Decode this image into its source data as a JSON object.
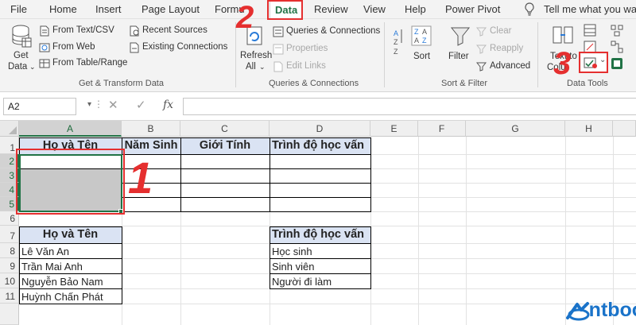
{
  "menu": {
    "tabs": [
      "File",
      "Home",
      "Insert",
      "Page Layout",
      "Formu",
      "Data",
      "Review",
      "View",
      "Help",
      "Power Pivot"
    ],
    "active_tab": "Data",
    "tell_me": "Tell me what you wan"
  },
  "ribbon": {
    "get_transform": {
      "get_data": "Get",
      "get_data_2": "Data",
      "from_text_csv": "From Text/CSV",
      "from_web": "From Web",
      "from_table_range": "From Table/Range",
      "recent_sources": "Recent Sources",
      "existing_connections": "Existing Connections",
      "label": "Get & Transform Data"
    },
    "queries": {
      "refresh": "Refresh",
      "refresh_2": "All",
      "queries_connections": "Queries & Connections",
      "properties": "Properties",
      "edit_links": "Edit Links",
      "label": "Queries & Connections"
    },
    "sort_filter": {
      "sort": "Sort",
      "filter": "Filter",
      "clear": "Clear",
      "reapply": "Reapply",
      "advanced": "Advanced",
      "label": "Sort & Filter"
    },
    "data_tools": {
      "text_to_columns": "Text to",
      "text_to_columns_2": "Colu",
      "label": "Data Tools"
    }
  },
  "formula_bar": {
    "name_box": "A2",
    "fx": "fx"
  },
  "grid": {
    "columns": [
      "A",
      "B",
      "C",
      "D",
      "E",
      "F",
      "G",
      "H"
    ],
    "rows": [
      "1",
      "2",
      "3",
      "4",
      "5",
      "6",
      "7",
      "8",
      "9",
      "10",
      "11"
    ],
    "header_row": [
      "Họ và Tên",
      "Năm Sinh",
      "Giới Tính",
      "Trình độ học vấn"
    ],
    "names_header": "Họ và Tên",
    "names": [
      "Lê Văn An",
      "Trần Mai Anh",
      "Nguyễn Bảo Nam",
      "Huỳnh Chấn Phát"
    ],
    "edu_header": "Trình độ học vấn",
    "edu": [
      "Học sinh",
      "Sinh viên",
      "Người đi làm"
    ]
  },
  "annotations": {
    "step1": "1",
    "step2": "2",
    "step3": "3",
    "color": "#e52f2f"
  },
  "brand": {
    "logo_text": "ntbook",
    "color": "#1a73c9"
  },
  "colors": {
    "excel_green": "#217346",
    "header_blue": "#dae3f3",
    "selection_gray": "#c8c8c8"
  }
}
